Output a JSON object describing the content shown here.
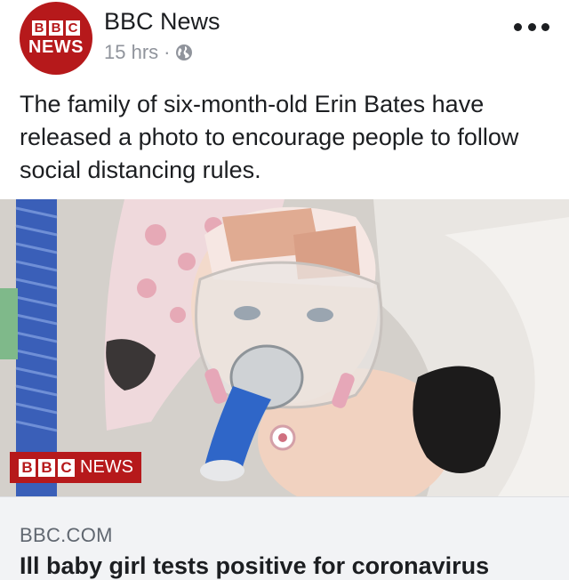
{
  "header": {
    "avatar": {
      "blocks": [
        "B",
        "B",
        "C"
      ],
      "word": "NEWS",
      "color": "#b6191b"
    },
    "page_name": "BBC News",
    "timestamp": "15 hrs",
    "separator": "·",
    "privacy_icon": "globe-icon",
    "more_icon": "more-dots-icon"
  },
  "post": {
    "text": "The family of six-month-old Erin Bates have released a photo to encourage people to follow social distancing rules."
  },
  "photo": {
    "watermark_blocks": [
      "B",
      "B",
      "C"
    ],
    "watermark_word": "NEWS"
  },
  "link_preview": {
    "domain": "BBC.COM",
    "title": "Ill baby girl tests positive for coronavirus"
  },
  "colors": {
    "brand_red": "#b6191b",
    "link_background": "#f2f3f5",
    "meta_gray": "#90949c"
  }
}
